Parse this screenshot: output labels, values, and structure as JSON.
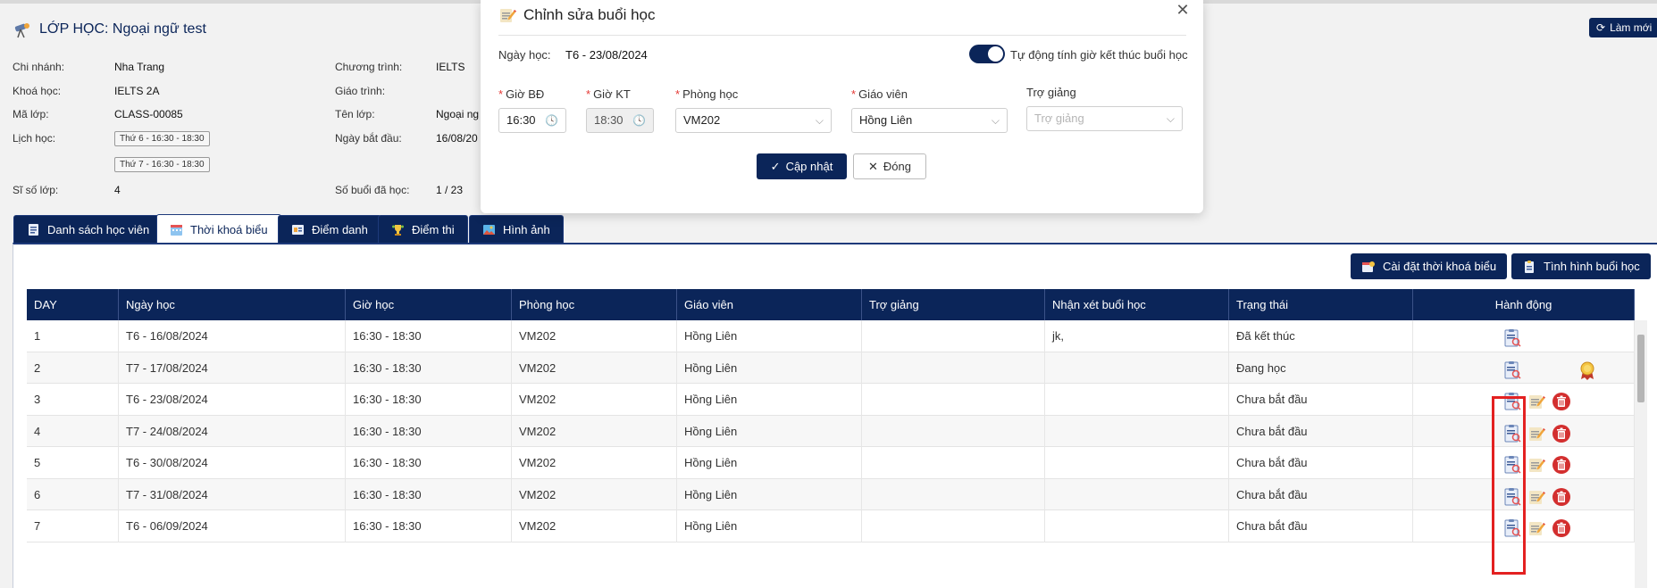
{
  "header": {
    "class_title": "LỚP HỌC: Ngoại ngữ test",
    "refresh_label": "Làm mới"
  },
  "info": {
    "branch_label": "Chi nhánh:",
    "branch_value": "Nha Trang",
    "course_label": "Khoá học:",
    "course_value": "IELTS 2A",
    "code_label": "Mã lớp:",
    "code_value": "CLASS-00085",
    "schedule_label": "Lịch học:",
    "schedule_chips": [
      "Thứ 6 - 16:30 - 18:30",
      "Thứ 7 - 16:30 - 18:30"
    ],
    "size_label": "Sĩ số lớp:",
    "size_value": "4",
    "program_label": "Chương trình:",
    "program_value": "IELTS",
    "curriculum_label": "Giáo trình:",
    "name_label": "Tên lớp:",
    "name_value": "Ngoại ng",
    "start_label": "Ngày bắt đầu:",
    "start_value": "16/08/20",
    "sessions_label": "Số buổi đã học:",
    "sessions_value": "1 / 23"
  },
  "tabs": [
    {
      "label": "Danh sách học viên"
    },
    {
      "label": "Thời khoá biểu"
    },
    {
      "label": "Điểm danh"
    },
    {
      "label": "Điểm thi"
    },
    {
      "label": "Hình ảnh"
    }
  ],
  "toolbar": {
    "setup_label": "Cài đặt thời khoá biểu",
    "status_label": "Tình hình buổi học"
  },
  "table": {
    "headers": [
      "DAY",
      "Ngày học",
      "Giờ học",
      "Phòng học",
      "Giáo viên",
      "Trợ giảng",
      "Nhận xét buổi học",
      "Trạng thái",
      "Hành động"
    ],
    "rows": [
      {
        "day": "1",
        "date": "T6 - 16/08/2024",
        "time": "16:30 - 18:30",
        "room": "VM202",
        "teacher": "Hồng Liên",
        "assistant": "",
        "comment": "jk,",
        "status": "Đã kết thúc"
      },
      {
        "day": "2",
        "date": "T7 - 17/08/2024",
        "time": "16:30 - 18:30",
        "room": "VM202",
        "teacher": "Hồng Liên",
        "assistant": "",
        "comment": "",
        "status": "Đang học"
      },
      {
        "day": "3",
        "date": "T6 - 23/08/2024",
        "time": "16:30 - 18:30",
        "room": "VM202",
        "teacher": "Hồng Liên",
        "assistant": "",
        "comment": "",
        "status": "Chưa bắt đầu"
      },
      {
        "day": "4",
        "date": "T7 - 24/08/2024",
        "time": "16:30 - 18:30",
        "room": "VM202",
        "teacher": "Hồng Liên",
        "assistant": "",
        "comment": "",
        "status": "Chưa bắt đầu"
      },
      {
        "day": "5",
        "date": "T6 - 30/08/2024",
        "time": "16:30 - 18:30",
        "room": "VM202",
        "teacher": "Hồng Liên",
        "assistant": "",
        "comment": "",
        "status": "Chưa bắt đầu"
      },
      {
        "day": "6",
        "date": "T7 - 31/08/2024",
        "time": "16:30 - 18:30",
        "room": "VM202",
        "teacher": "Hồng Liên",
        "assistant": "",
        "comment": "",
        "status": "Chưa bắt đầu"
      },
      {
        "day": "7",
        "date": "T6 - 06/09/2024",
        "time": "16:30 - 18:30",
        "room": "VM202",
        "teacher": "Hồng Liên",
        "assistant": "",
        "comment": "",
        "status": "Chưa bắt đầu"
      }
    ]
  },
  "modal": {
    "title": "Chỉnh sửa buổi học",
    "date_label": "Ngày học:",
    "date_value": "T6 - 23/08/2024",
    "auto_label": "Tự động tính giờ kết thúc buổi học",
    "start_label": "Giờ BĐ",
    "start_value": "16:30",
    "end_label": "Giờ KT",
    "end_value": "18:30",
    "room_label": "Phòng học",
    "room_value": "VM202",
    "teacher_label": "Giáo viên",
    "teacher_value": "Hồng Liên",
    "assistant_label": "Trợ giảng",
    "assistant_placeholder": "Trợ giảng",
    "update_label": "Cập nhật",
    "close_label": "Đóng"
  },
  "colors": {
    "primary": "#0b2559",
    "danger": "#d32f2f",
    "highlight": "#e32121"
  }
}
